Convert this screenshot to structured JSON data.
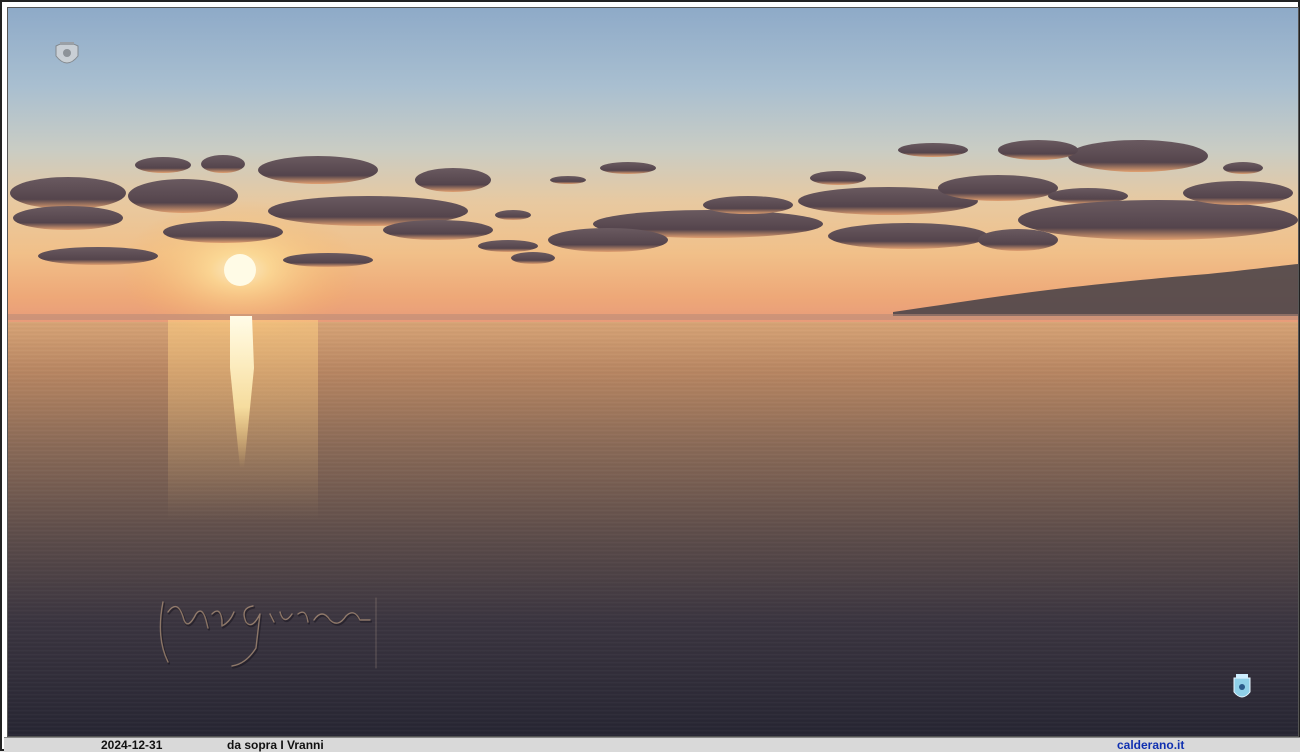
{
  "photo": {
    "scene": "sunset-over-sea",
    "signature_text": "Cap. Calderaro",
    "colors": {
      "sun": "#fff6c8",
      "sun_glow": "#ffd27a",
      "cloud": "#5a4a52",
      "cloud_edge": "#f0b070",
      "land": "#4a4448"
    }
  },
  "icons": {
    "top_left": "coat-of-arms-icon",
    "bottom_right": "crest-icon"
  },
  "footer": {
    "date": "2024-12-31",
    "caption": "da sopra I Vranni",
    "site": "calderano.it",
    "site_color": "#1030b0"
  }
}
